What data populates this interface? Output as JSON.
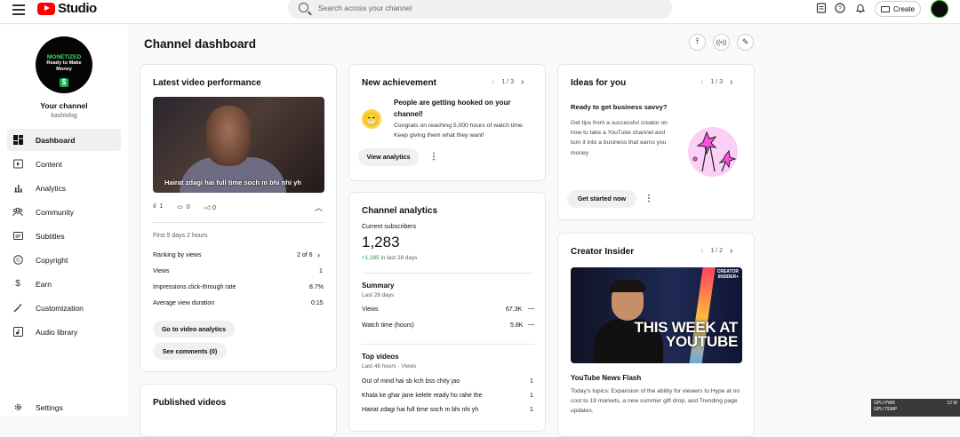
{
  "header": {
    "logo_text": "Studio",
    "search_placeholder": "Search across your channel",
    "create_label": "Create",
    "icons": [
      "menu-icon",
      "captions-icon",
      "help-icon",
      "notifications-icon",
      "video-camera-icon"
    ]
  },
  "sidebar": {
    "avatar": {
      "line1": "MONETIZED",
      "line2": "Ready to Make",
      "line3": "Money",
      "symbol": "$"
    },
    "channel_label": "Your channel",
    "channel_handle": "kashivlog",
    "items": [
      {
        "label": "Dashboard",
        "icon": "dashboard-icon",
        "active": true
      },
      {
        "label": "Content",
        "icon": "content-icon"
      },
      {
        "label": "Analytics",
        "icon": "analytics-icon"
      },
      {
        "label": "Community",
        "icon": "community-icon"
      },
      {
        "label": "Subtitles",
        "icon": "subtitles-icon"
      },
      {
        "label": "Copyright",
        "icon": "copyright-icon"
      },
      {
        "label": "Earn",
        "icon": "dollar-icon"
      },
      {
        "label": "Customization",
        "icon": "magic-wand-icon"
      },
      {
        "label": "Audio library",
        "icon": "audio-library-icon"
      }
    ],
    "settings_label": "Settings"
  },
  "page": {
    "title": "Channel dashboard"
  },
  "latest_video": {
    "title": "Latest video performance",
    "video_title": "Hairat zdagi hai full time soch m bhi nhi yh",
    "views_stat": "1",
    "comments_stat": "0",
    "likes_stat": "0",
    "period": "First 5 days 2 hours",
    "ranking_label": "Ranking by views",
    "ranking_value": "2 of 6",
    "views_label": "Views",
    "views_value": "1",
    "ctr_label": "Impressions click-through rate",
    "ctr_value": "8.7%",
    "avd_label": "Average view duration",
    "avd_value": "0:15",
    "btn_analytics": "Go to video analytics",
    "btn_comments": "See comments (0)"
  },
  "published": {
    "title": "Published videos"
  },
  "achievement": {
    "title": "New achievement",
    "pager": "1 / 3",
    "headline": "People are getting hooked on your channel!",
    "body": "Congrats on reaching 5,000 hours of watch time. Keep giving them what they want!",
    "btn": "View analytics"
  },
  "channel_analytics": {
    "title": "Channel analytics",
    "subs_label": "Current subscribers",
    "subs_value": "1,283",
    "subs_change": "+1,285",
    "subs_change_period": "in last 28 days",
    "summary_title": "Summary",
    "summary_period": "Last 28 days",
    "views_label": "Views",
    "views_value": "67.3K",
    "watch_label": "Watch time (hours)",
    "watch_value": "5.8K",
    "top_title": "Top videos",
    "top_period": "Last 48 hours · Views",
    "top_videos": [
      {
        "title": "Out of mind hai sb kch bss chity jao",
        "views": "1"
      },
      {
        "title": "Khala ke ghar jane kelele ready ho rahe the",
        "views": "1"
      },
      {
        "title": "Hairat zdagi hai full time soch m bhi nhi yh",
        "views": "1"
      }
    ]
  },
  "ideas": {
    "title": "Ideas for you",
    "pager": "1 / 3",
    "headline": "Ready to get business savvy?",
    "body": "Get tips from a successful creator on how to take a YouTube channel and turn it into a business that earns you money",
    "btn": "Get started now"
  },
  "insider": {
    "title": "Creator Insider",
    "pager": "1 / 2",
    "thumb_text": "THIS WEEK AT YOUTUBE",
    "badge": "CREATOR INSIDER+",
    "news_title": "YouTube News Flash",
    "news_body": "Today's topics: Expansion of the ability for viewers to Hype at no cost to 19 markets, a new summer gift drop, and Trending page updates."
  },
  "overlay": {
    "gpu_line1": "GPU PWR",
    "gpu_val1": "12 W",
    "gpu_line2": "GPU TEMP"
  }
}
